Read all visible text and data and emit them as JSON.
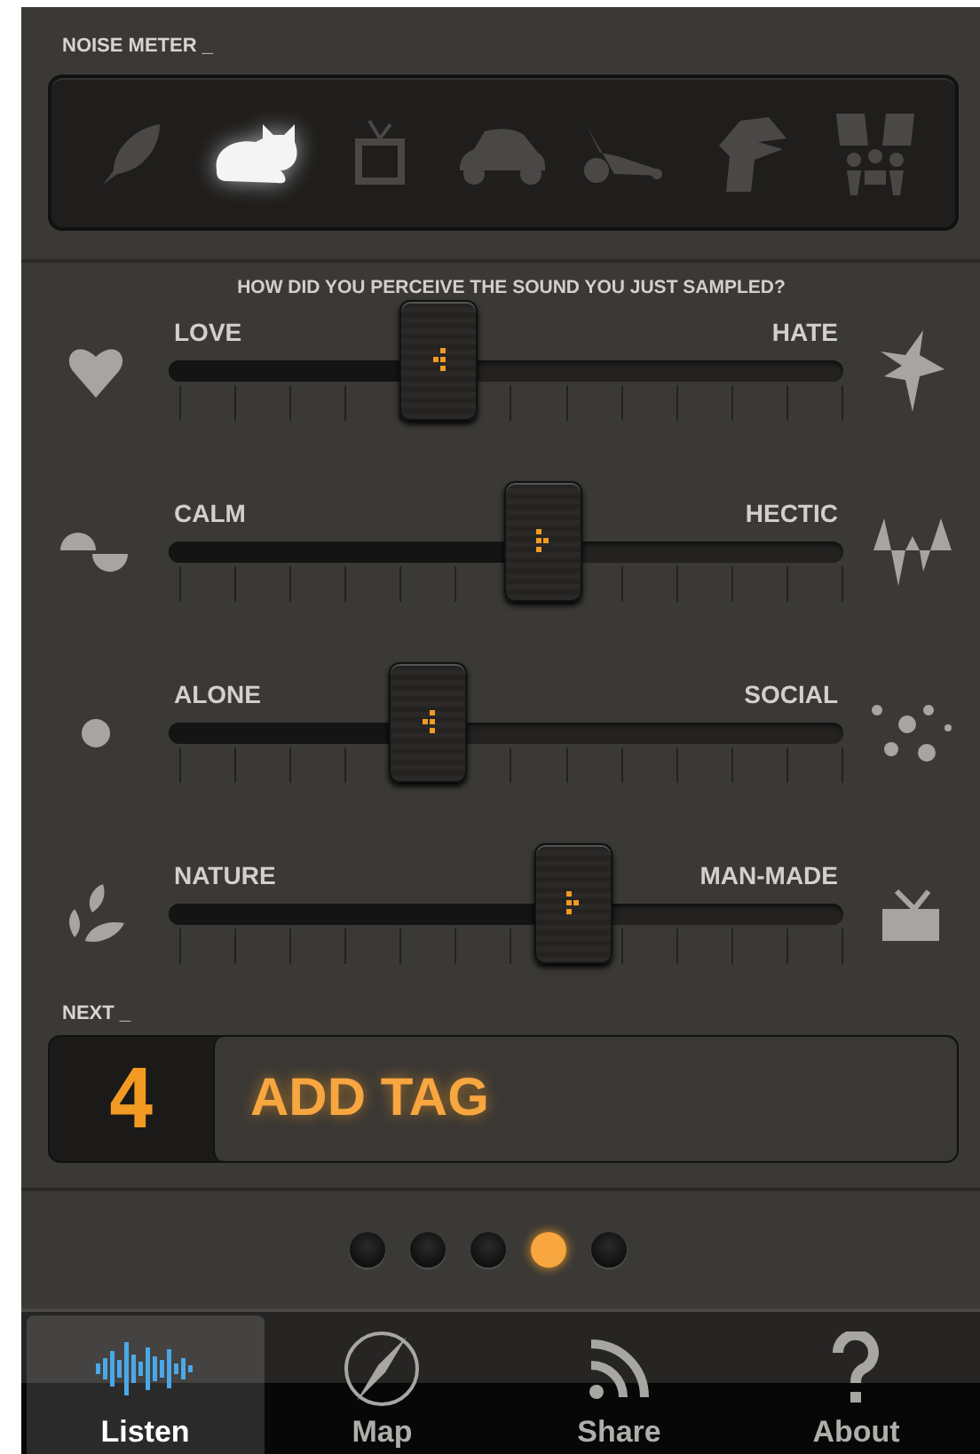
{
  "noise_meter": {
    "label": "NOISE METER _",
    "levels": [
      {
        "selected": false
      },
      {
        "selected": true
      },
      {
        "selected": false
      },
      {
        "selected": false
      },
      {
        "selected": false
      },
      {
        "selected": false
      },
      {
        "selected": false
      }
    ]
  },
  "question": "HOW DID YOU PERCEIVE THE SOUND YOU JUST SAMPLED?",
  "sliders": [
    {
      "left_label": "LOVE",
      "right_label": "HATE",
      "level": 0.4
    },
    {
      "left_label": "CALM",
      "right_label": "HECTIC",
      "level": 0.555
    },
    {
      "left_label": "ALONE",
      "right_label": "SOCIAL",
      "level": 0.385
    },
    {
      "left_label": "NATURE",
      "right_label": "MAN-MADE",
      "level": 0.6
    }
  ],
  "next": {
    "label": "NEXT _",
    "counter": "4",
    "action": "ADD TAG"
  },
  "pager": [
    {
      "selected": false
    },
    {
      "selected": false
    },
    {
      "selected": false
    },
    {
      "selected": true
    },
    {
      "selected": false
    }
  ],
  "tabs": [
    {
      "label": "Listen",
      "selected": true
    },
    {
      "label": "Map",
      "selected": false
    },
    {
      "label": "Share",
      "selected": false
    },
    {
      "label": "About",
      "selected": false
    }
  ]
}
